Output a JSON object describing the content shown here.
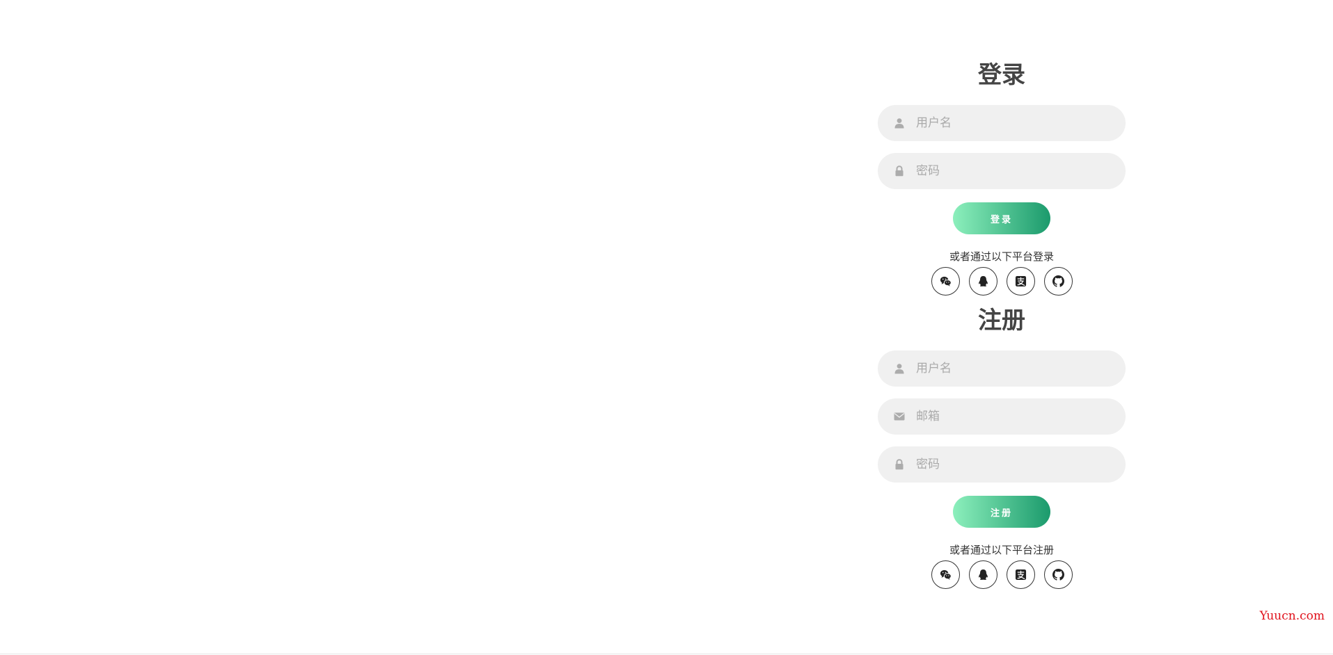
{
  "login": {
    "title": "登录",
    "username_placeholder": "用户名",
    "password_placeholder": "密码",
    "submit_label": "登录",
    "social_text": "或者通过以下平台登录",
    "social_icons": [
      "wechat-icon",
      "qq-icon",
      "alipay-icon",
      "github-icon"
    ]
  },
  "register": {
    "title": "注册",
    "username_placeholder": "用户名",
    "email_placeholder": "邮箱",
    "password_placeholder": "密码",
    "submit_label": "注册",
    "social_text": "或者通过以下平台注册",
    "social_icons": [
      "wechat-icon",
      "qq-icon",
      "alipay-icon",
      "github-icon"
    ]
  },
  "field_icons": {
    "username": "user-icon",
    "email": "envelope-icon",
    "password": "lock-icon"
  },
  "colors": {
    "field_background": "#f0f0f0",
    "button_gradient_start": "#8cefbc",
    "button_gradient_end": "#1b9a6c",
    "watermark": "#e0111b"
  },
  "watermark": "Yuucn.com"
}
